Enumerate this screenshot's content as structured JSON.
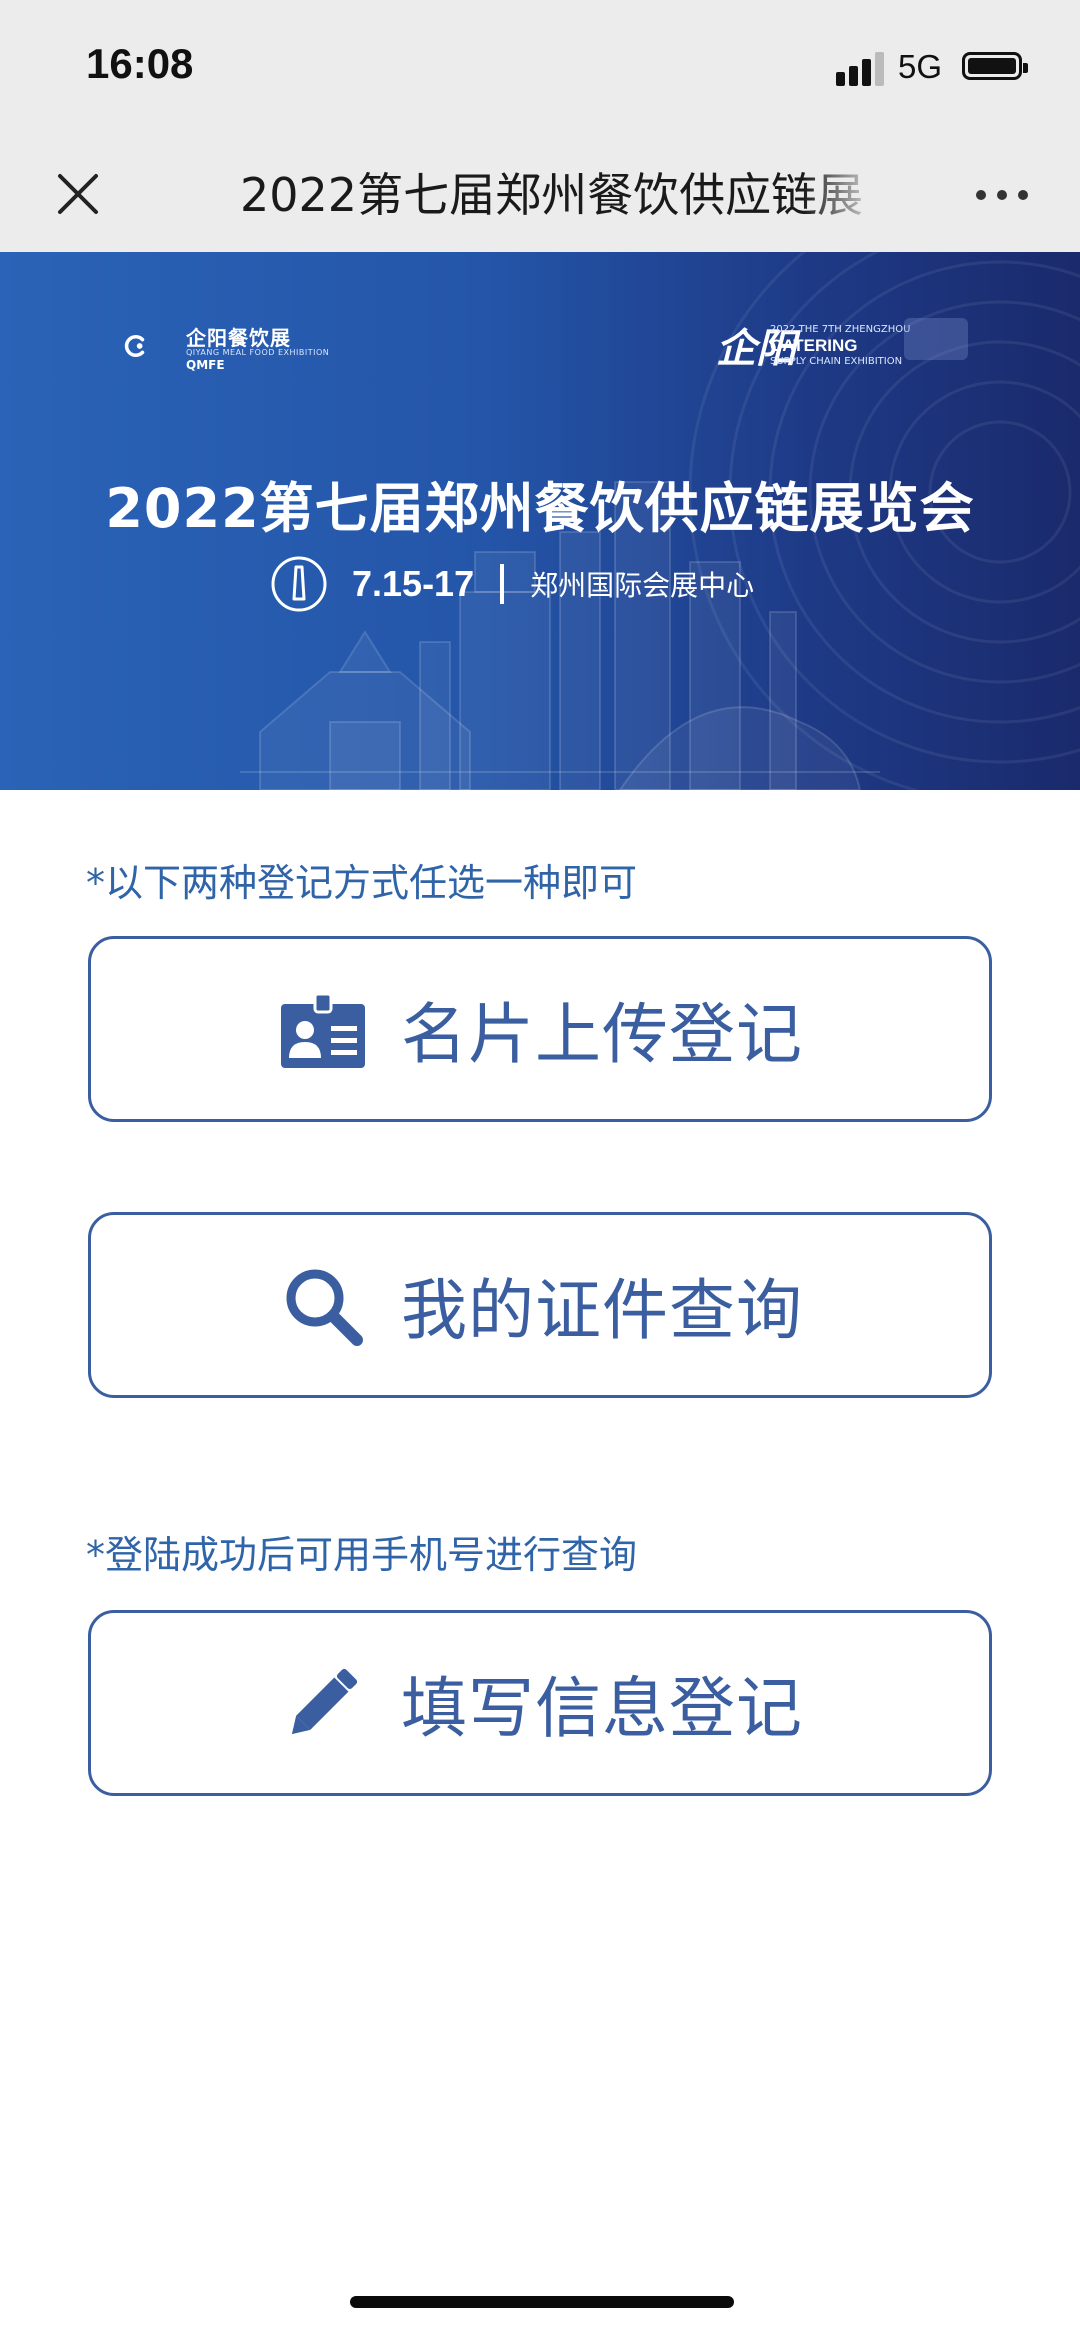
{
  "status_bar": {
    "time": "16:08",
    "network": "5G"
  },
  "nav": {
    "title": "2022第七届郑州餐饮供应链展",
    "close_icon": "close-icon",
    "more_icon": "more-icon"
  },
  "banner": {
    "logo_left": {
      "name": "企阳餐饮展",
      "subtitle": "QIYANG MEAL FOOD EXHIBITION",
      "code": "QMFE"
    },
    "logo_right": {
      "mark": "企阳",
      "top": "2022 THE 7TH ZHENGZHOU",
      "main": "CATERING",
      "sub": "SUPPLY CHAIN EXHIBITION"
    },
    "title": "2022第七届郑州餐饮供应链展览会",
    "date": "7.15-17",
    "venue": "郑州国际会展中心"
  },
  "content": {
    "note_1": "*以下两种登记方式任选一种即可",
    "buttons": [
      {
        "label": "名片上传登记",
        "icon": "id-card-icon"
      },
      {
        "label": "我的证件查询",
        "icon": "search-icon"
      }
    ],
    "note_2": "*登陆成功后可用手机号进行查询",
    "form_button": {
      "label": "填写信息登记",
      "icon": "pencil-icon"
    }
  },
  "colors": {
    "accent": "#3a5ea0",
    "note_text": "#2f64a8",
    "banner_start": "#2a63b7",
    "banner_end": "#1a2a6c",
    "chrome_bg": "#ececec"
  }
}
